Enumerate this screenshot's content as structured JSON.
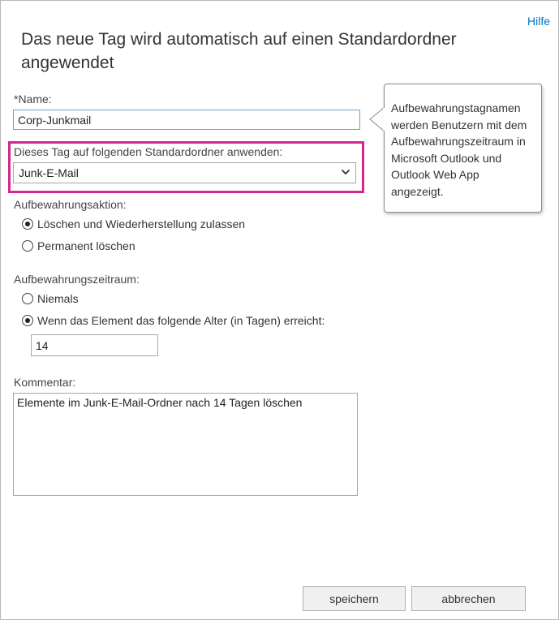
{
  "header": {
    "help_link": "Hilfe",
    "title": "Das neue Tag wird automatisch auf einen Standardordner angewendet"
  },
  "name_field": {
    "label": "*Name:",
    "value": "Corp-Junkmail"
  },
  "default_folder": {
    "label": "Dieses Tag auf folgenden Standardordner anwenden:",
    "selected": "Junk-E-Mail",
    "highlight_color": "#d3288f"
  },
  "retention_action": {
    "label": "Aufbewahrungsaktion:",
    "options": [
      {
        "label": "Löschen und Wiederherstellung zulassen",
        "checked": true
      },
      {
        "label": "Permanent löschen",
        "checked": false
      }
    ]
  },
  "retention_period": {
    "label": "Aufbewahrungszeitraum:",
    "options": [
      {
        "label": "Niemals",
        "checked": false
      },
      {
        "label": "Wenn das Element das folgende Alter (in Tagen) erreicht:",
        "checked": true
      }
    ],
    "days_value": "14"
  },
  "comment": {
    "label": "Kommentar:",
    "value": "Elemente im Junk-E-Mail-Ordner nach 14 Tagen löschen"
  },
  "tooltip": {
    "text": "Aufbewahrungstagnamen werden Benutzern mit dem Aufbewahrungszeitraum in Microsoft Outlook und Outlook Web App angezeigt."
  },
  "buttons": {
    "save": "speichern",
    "cancel": "abbrechen"
  },
  "colors": {
    "link": "#0072c6",
    "focus_border": "#6aa3d8"
  },
  "icons": {
    "dropdown": "chevron-down-icon"
  }
}
